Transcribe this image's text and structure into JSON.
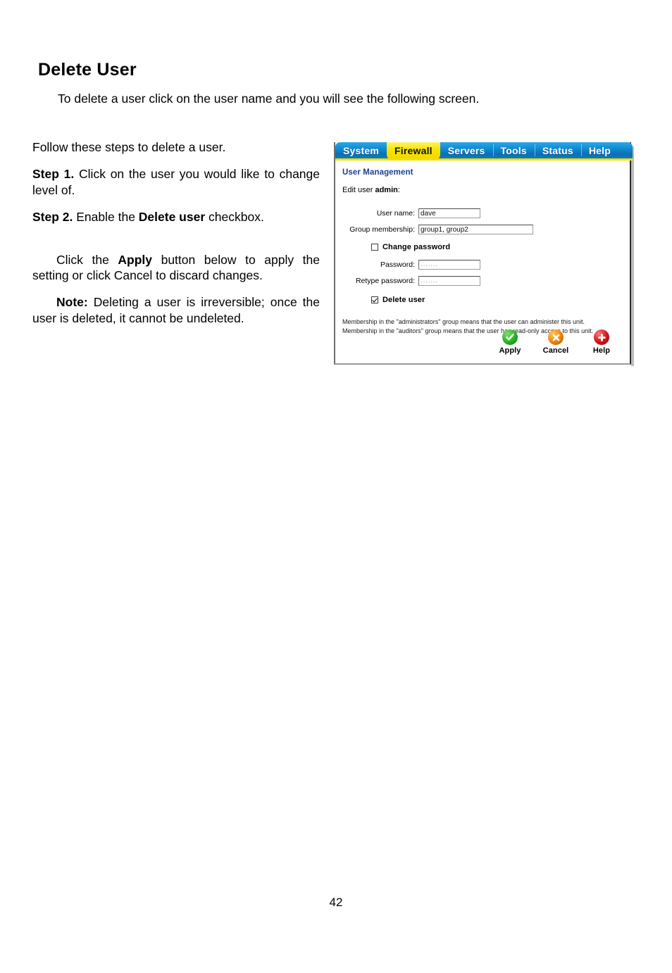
{
  "document": {
    "heading": "Delete User",
    "intro": "To delete a user click on the user name and you will see the following screen.",
    "paragraphs": [
      {
        "id": "follow",
        "text": "Follow these steps to delete a user."
      },
      {
        "id": "step1_label",
        "text": "Step 1.",
        "rest": " Click on the user you would like to change level of."
      },
      {
        "id": "step2_label",
        "text": "Step 2.",
        "mid": " Enable the ",
        "bold2": "Delete user",
        "rest": " checkbox."
      },
      {
        "id": "apply_para_pre",
        "text": "Click the ",
        "bold": "Apply",
        "rest": " button below to apply the setting or click Cancel to discard changes."
      },
      {
        "id": "note_para",
        "label": "Note:",
        "rest": " Deleting a user is irreversible; once the user is deleted, it cannot be undeleted."
      }
    ],
    "page_number": "42"
  },
  "screenshot": {
    "nav": {
      "tabs": [
        {
          "label": "System",
          "active": false
        },
        {
          "label": "Firewall",
          "active": true
        },
        {
          "label": "Servers",
          "active": false
        },
        {
          "label": "Tools",
          "active": false
        },
        {
          "label": "Status",
          "active": false
        },
        {
          "label": "Help",
          "active": false
        }
      ],
      "active_tab_color": "#f7e400",
      "bar_color": "#0f86cf"
    },
    "panel": {
      "title": "User Management",
      "edit_prefix": "Edit user ",
      "edit_user": "admin",
      "edit_suffix": ":"
    },
    "form": {
      "username": {
        "label": "User name:",
        "value": "dave"
      },
      "group": {
        "label": "Group membership:",
        "value": "group1, group2"
      },
      "change_password": {
        "label": "Change password",
        "checked": false
      },
      "password": {
        "label": "Password:",
        "value": "·······"
      },
      "retype_password": {
        "label": "Retype password:",
        "value": "·······"
      },
      "delete_user": {
        "label": "Delete user",
        "checked": true
      }
    },
    "notes": {
      "line1": "Membership in the \"administrators\" group means that the user can administer this unit.",
      "line2": "Membership in the \"auditors\" group means that the user has read-only access to this unit."
    },
    "buttons": {
      "apply": {
        "label": "Apply",
        "icon": "check-circle-icon",
        "color": "#2fb82a"
      },
      "cancel": {
        "label": "Cancel",
        "icon": "x-circle-icon",
        "color": "#f08a10"
      },
      "help": {
        "label": "Help",
        "icon": "plus-circle-icon",
        "color": "#d41a1f"
      }
    }
  }
}
